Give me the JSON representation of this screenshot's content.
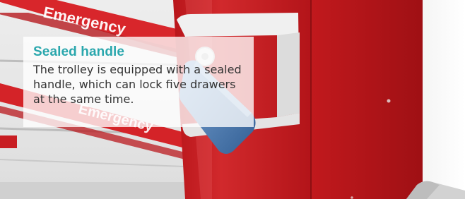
{
  "caption": {
    "title": "Sealed handle",
    "body": "The trolley is equipped with a sealed handle, which can lock five drawers at the same time."
  },
  "photo": {
    "drawer_label_top": "Emergency",
    "drawer_label_bottom": "Emergency"
  },
  "colors": {
    "accent": "#2aa7ad",
    "trolley_red": "#c51f24",
    "handle_blue": "#4f7fb3",
    "panel_white": "#e9e9e9"
  }
}
